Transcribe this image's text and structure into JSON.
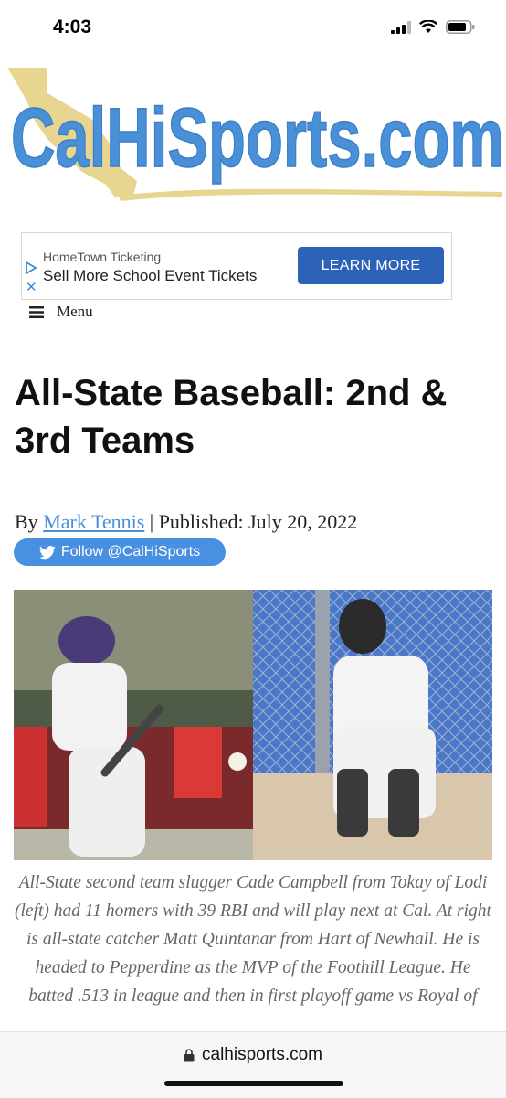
{
  "status_bar": {
    "time": "4:03"
  },
  "site": {
    "logo_text": "CalHiSports.com"
  },
  "ad": {
    "brand": "HomeTown Ticketing",
    "headline": "Sell More School Event Tickets",
    "cta": "LEARN MORE",
    "close_symbol": "✕"
  },
  "nav": {
    "menu_label": "Menu"
  },
  "article": {
    "title": "All-State Baseball: 2nd & 3rd Teams",
    "byline_prefix": "By ",
    "author": "Mark Tennis",
    "published": " | Published: July 20, 2022",
    "follow_label": "Follow @CalHiSports",
    "caption": "All-State second team slugger Cade Campbell from Tokay of Lodi (left) had 11 homers with 39 RBI and will play next at Cal. At right is all-state catcher Matt Quintanar from Hart of Newhall. He is headed to Pepperdine as the MVP of the Foothill League. He batted .513 in league and then in first playoff game vs Royal of"
  },
  "browser": {
    "url": "calhisports.com"
  },
  "colors": {
    "logo_blue": "#4a90d9",
    "logo_gold": "#e8d590",
    "ad_button": "#2c63b8",
    "twitter_blue": "#4a90e2",
    "link": "#4a90d9"
  },
  "icons": [
    "signal-icon",
    "wifi-icon",
    "battery-icon",
    "ad-choices-icon",
    "close-icon",
    "hamburger-icon",
    "twitter-bird-icon",
    "lock-icon"
  ]
}
